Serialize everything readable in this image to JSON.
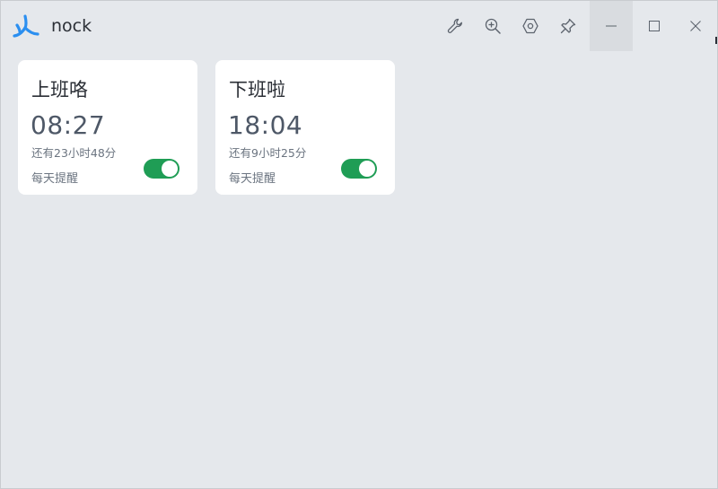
{
  "app": {
    "title": "nock",
    "logo_icon": "tri-leaf-logo",
    "accent": "#2b8ff0"
  },
  "toolbar": {
    "icons": [
      "wrench-icon",
      "zoom-in-icon",
      "settings-hexagon-icon",
      "pin-icon"
    ]
  },
  "window_controls": [
    "minimize-icon",
    "maximize-icon",
    "close-icon"
  ],
  "alarms": [
    {
      "title": "上班咯",
      "time": "08:27",
      "remaining": "还有23小时48分",
      "repeat": "每天提醒",
      "enabled": true
    },
    {
      "title": "下班啦",
      "time": "18:04",
      "remaining": "还有9小时25分",
      "repeat": "每天提醒",
      "enabled": true
    }
  ],
  "colors": {
    "background": "#e5e8ec",
    "card": "#ffffff",
    "toggle_on": "#1f9d55",
    "time_text": "#4e5867"
  }
}
